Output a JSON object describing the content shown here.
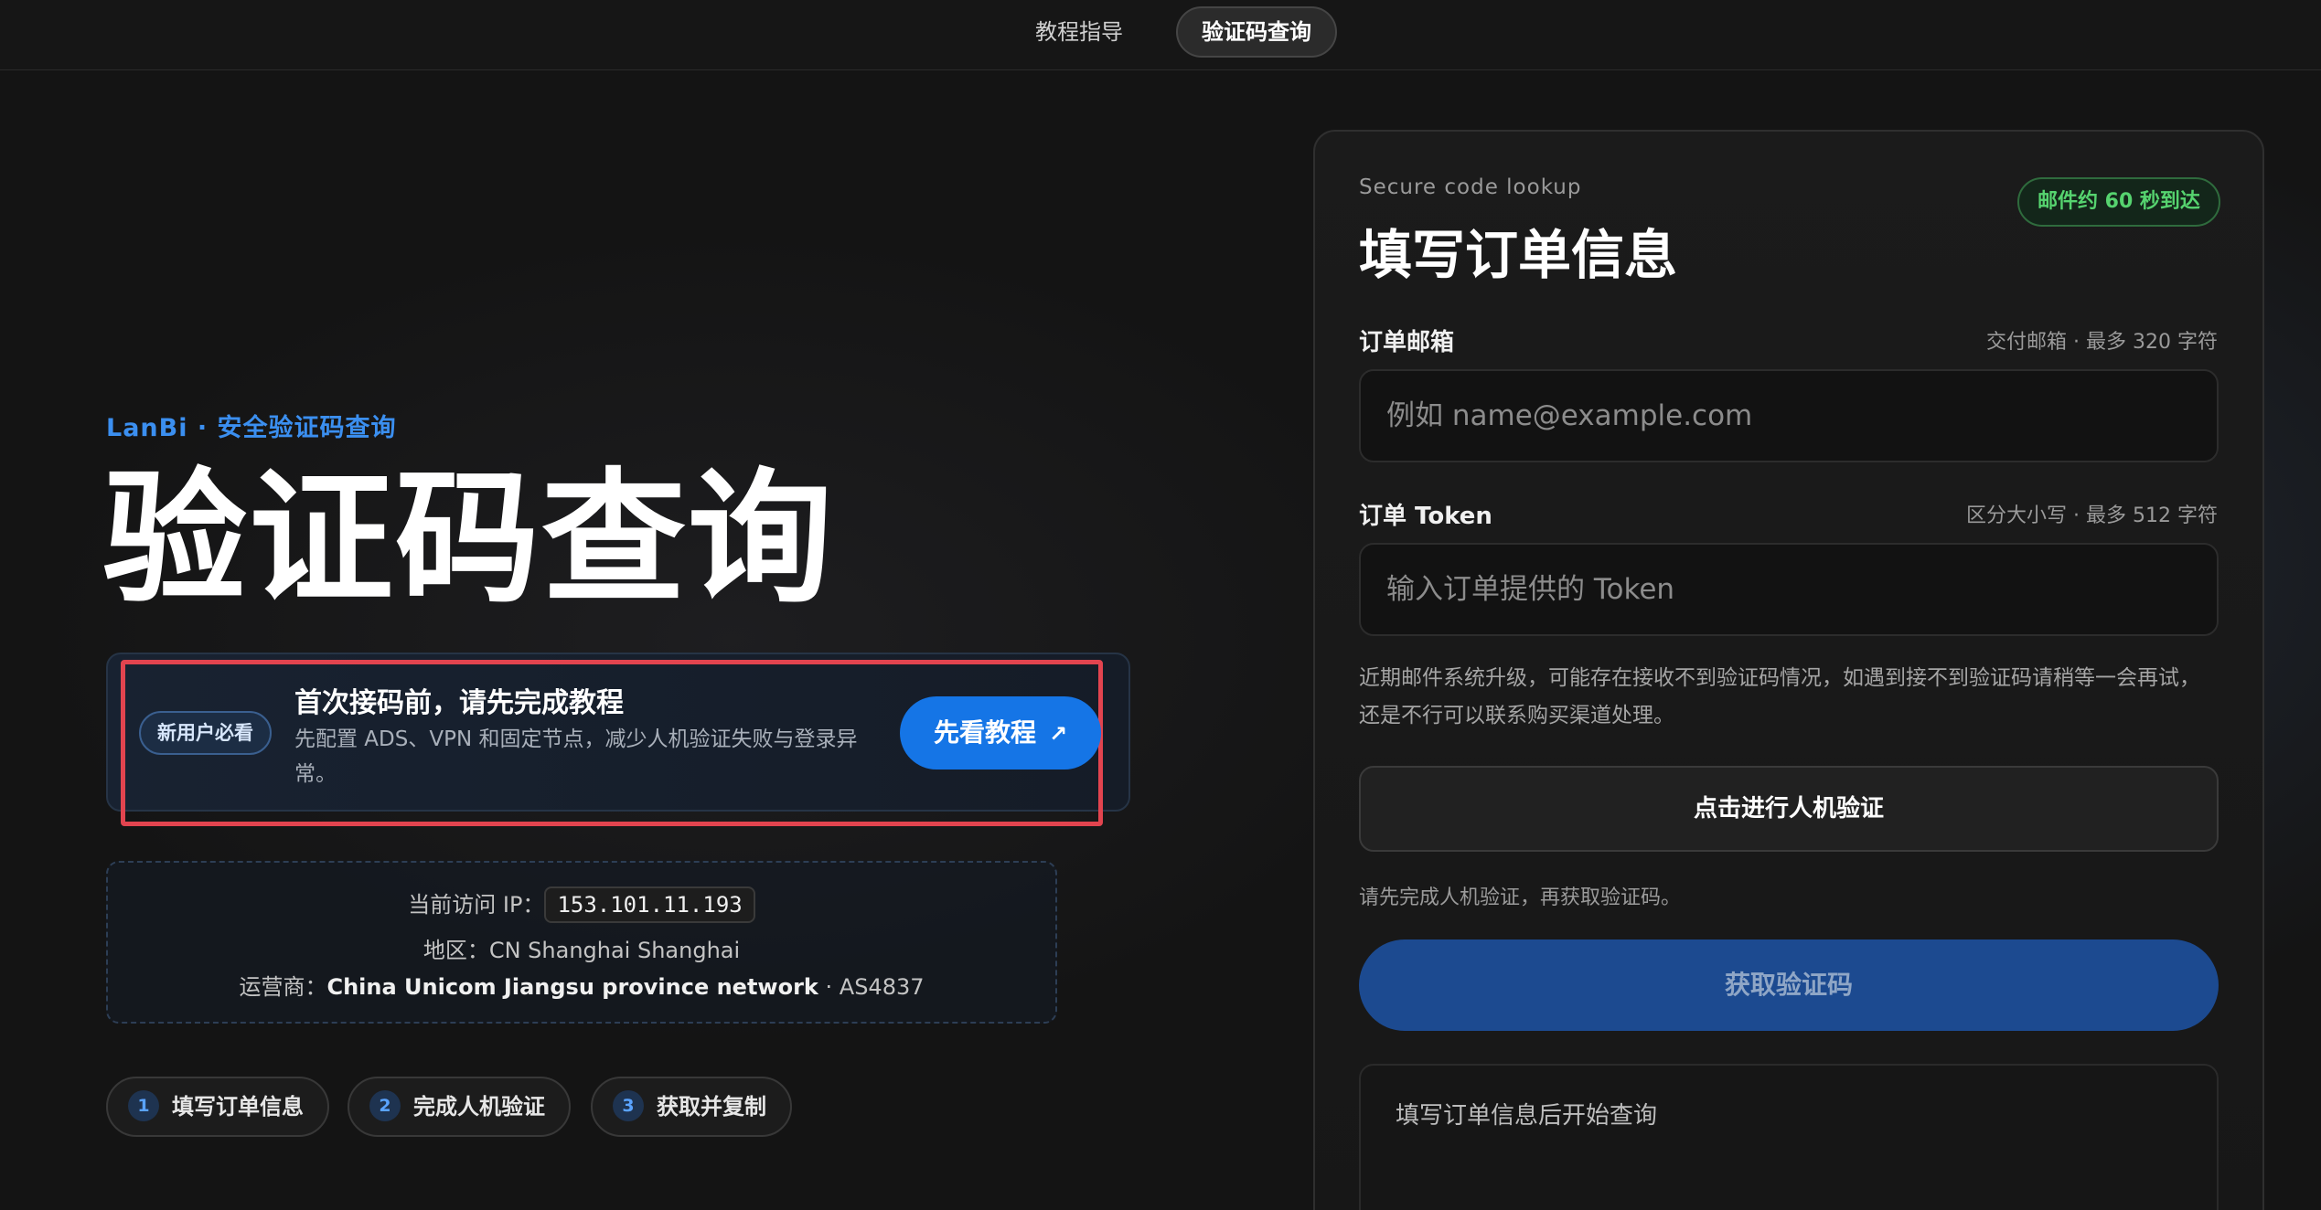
{
  "nav": {
    "tabs": [
      {
        "label": "教程指导",
        "active": false
      },
      {
        "label": "验证码查询",
        "active": true
      }
    ]
  },
  "hero": {
    "brand": "LanBi · 安全验证码查询",
    "title": "验证码查询"
  },
  "tutorial": {
    "badge": "新用户必看",
    "title": "首次接码前，请先完成教程",
    "description": "先配置 ADS、VPN 和固定节点，减少人机验证失败与登录异常。",
    "button_label": "先看教程",
    "button_icon": "arrow-up-right-icon"
  },
  "ip_info": {
    "ip_label": "当前访问 IP：",
    "ip_value": "153.101.11.193",
    "region_text": "地区：CN Shanghai Shanghai",
    "isp_label": "运营商：",
    "isp_value": "China Unicom Jiangsu province network",
    "asn": " · AS4837"
  },
  "steps": [
    {
      "num": "1",
      "label": "填写订单信息"
    },
    {
      "num": "2",
      "label": "完成人机验证"
    },
    {
      "num": "3",
      "label": "获取并复制"
    }
  ],
  "form": {
    "eyebrow": "Secure code lookup",
    "title": "填写订单信息",
    "badge": "邮件约 60 秒到达",
    "email": {
      "label": "订单邮箱",
      "hint": "交付邮箱 · 最多 320 字符",
      "placeholder": "例如 name@example.com",
      "value": ""
    },
    "token": {
      "label": "订单 Token",
      "hint": "区分大小写 · 最多 512 字符",
      "placeholder": "输入订单提供的 Token",
      "value": ""
    },
    "notice": "近期邮件系统升级，可能存在接收不到验证码情况，如遇到接不到验证码请稍等一会再试，还是不行可以联系购买渠道处理。",
    "verify_button": "点击进行人机验证",
    "verify_note": "请先完成人机验证，再获取验证码。",
    "get_button": "获取验证码",
    "result_text": "填写订单信息后开始查询"
  },
  "colors": {
    "accent": "#1575e6",
    "brand_text": "#3b8ff0",
    "highlight_border": "#e2444f",
    "badge_green": "#56d36f"
  }
}
